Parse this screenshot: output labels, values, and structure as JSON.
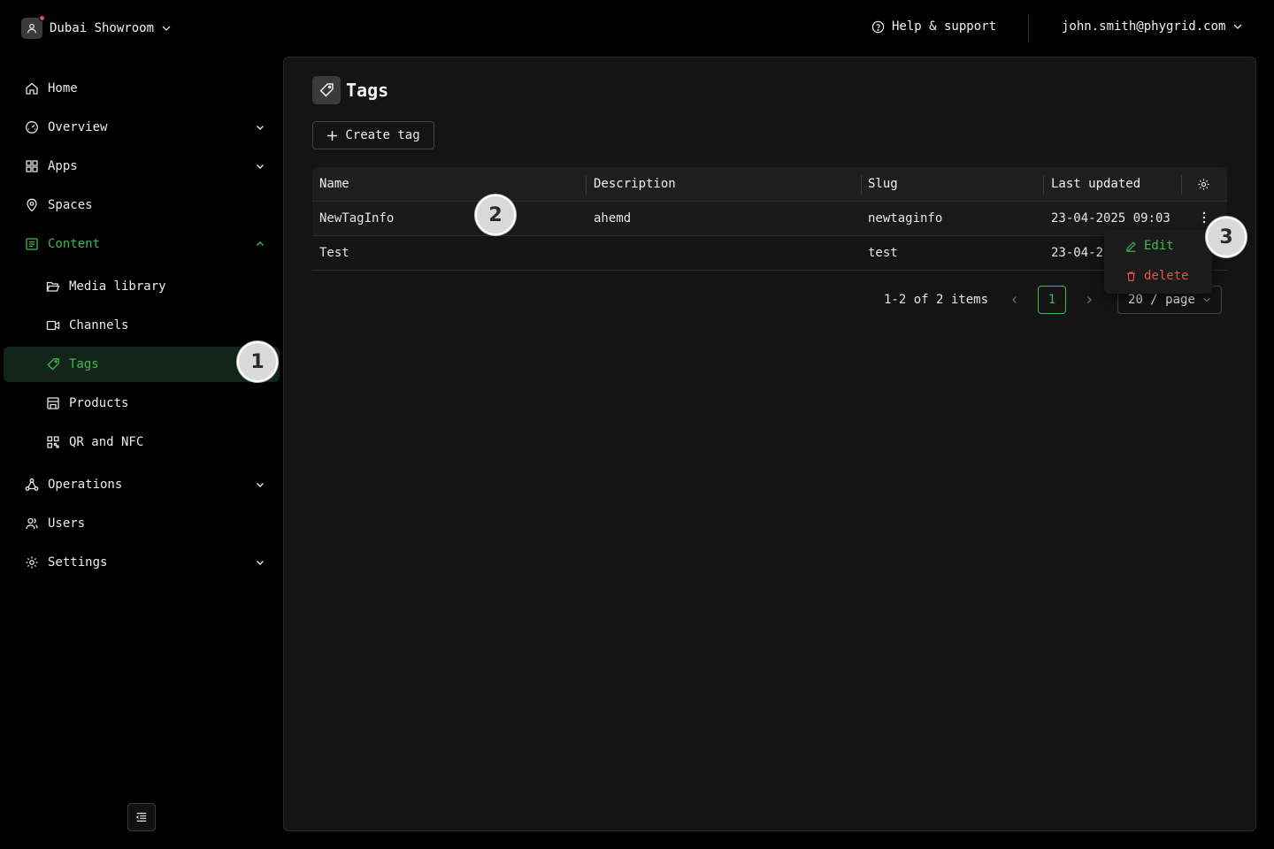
{
  "header": {
    "workspace_name": "Dubai Showroom",
    "help_label": "Help & support",
    "user_email": "john.smith@phygrid.com"
  },
  "sidebar": {
    "items": [
      {
        "label": "Home"
      },
      {
        "label": "Overview"
      },
      {
        "label": "Apps"
      },
      {
        "label": "Spaces"
      },
      {
        "label": "Content"
      },
      {
        "label": "Media library"
      },
      {
        "label": "Channels"
      },
      {
        "label": "Tags"
      },
      {
        "label": "Products"
      },
      {
        "label": "QR and NFC"
      },
      {
        "label": "Operations"
      },
      {
        "label": "Users"
      },
      {
        "label": "Settings"
      }
    ]
  },
  "main": {
    "title": "Tags",
    "create_label": "Create tag",
    "table": {
      "columns": [
        "Name",
        "Description",
        "Slug",
        "Last updated"
      ],
      "rows": [
        {
          "name": "NewTagInfo",
          "description": "ahemd",
          "slug": "newtaginfo",
          "updated": "23-04-2025 09:03"
        },
        {
          "name": "Test",
          "description": "",
          "slug": "test",
          "updated": "23-04-20"
        }
      ]
    },
    "pagination": {
      "info": "1-2 of 2 items",
      "current_page": "1",
      "page_size": "20 / page"
    },
    "row_menu": {
      "edit_label": "Edit",
      "delete_label": "delete"
    }
  },
  "annotations": [
    "1",
    "2",
    "3"
  ],
  "colors": {
    "accent_green": "#3fb950",
    "danger_red": "#e5534b",
    "active_bg": "#13251a"
  }
}
